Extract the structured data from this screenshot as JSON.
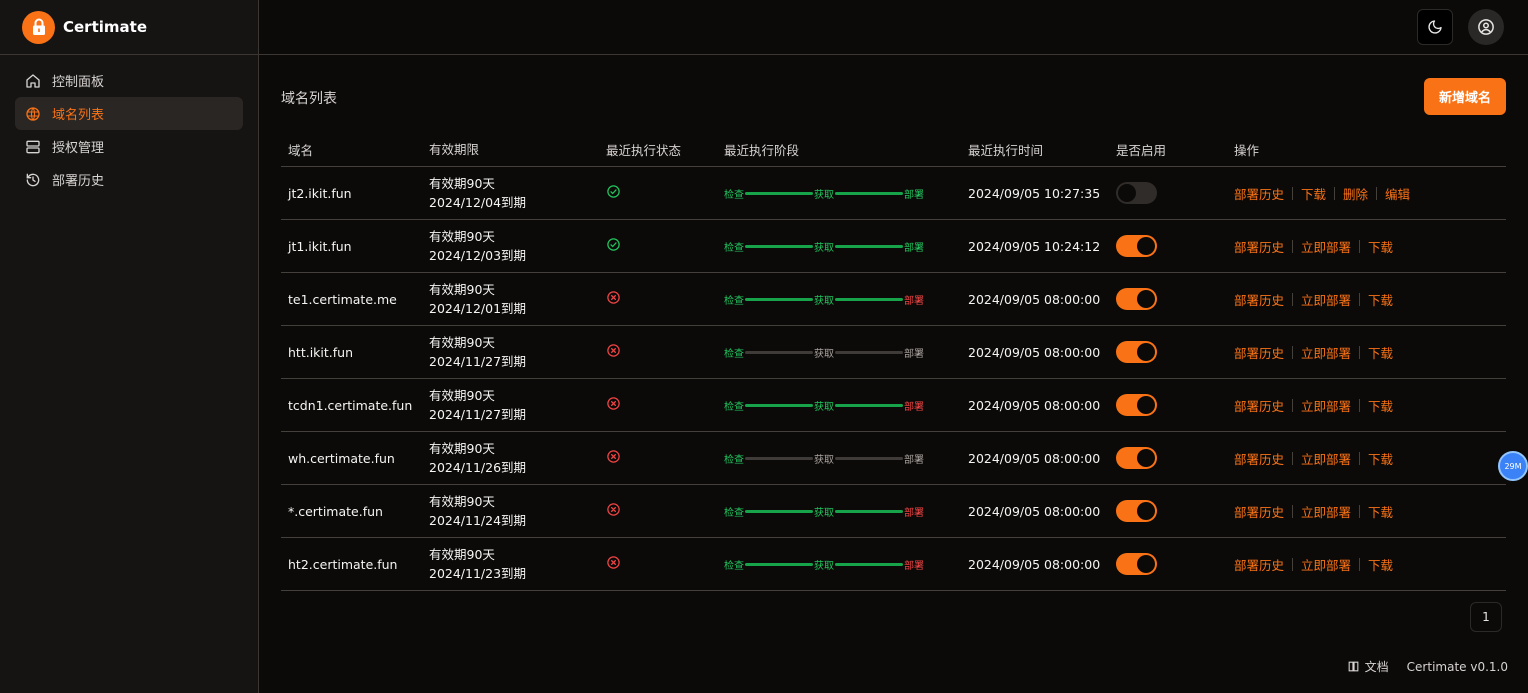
{
  "app": {
    "name": "Certimate"
  },
  "sidebar": {
    "items": [
      {
        "label": "控制面板",
        "icon": "home-icon",
        "active": false
      },
      {
        "label": "域名列表",
        "icon": "globe-icon",
        "active": true
      },
      {
        "label": "授权管理",
        "icon": "server-icon",
        "active": false
      },
      {
        "label": "部署历史",
        "icon": "history-icon",
        "active": false
      }
    ]
  },
  "topbar": {
    "theme_icon": "moon-icon",
    "user_icon": "user-circle-icon"
  },
  "main": {
    "title": "域名列表",
    "add_button": "新增域名",
    "columns": [
      "域名",
      "有效期限",
      "最近执行状态",
      "最近执行阶段",
      "最近执行时间",
      "是否启用",
      "操作"
    ],
    "stage_labels": [
      "检查",
      "获取",
      "部署"
    ],
    "rows": [
      {
        "domain": "jt2.ikit.fun",
        "valid_days": "有效期90天",
        "expire": "2024/12/04到期",
        "status": "success",
        "stages": [
          "green",
          "green",
          "green"
        ],
        "time": "2024/09/05 10:27:35",
        "enabled": false,
        "ops": [
          "部署历史",
          "下载",
          "删除",
          "编辑"
        ]
      },
      {
        "domain": "jt1.ikit.fun",
        "valid_days": "有效期90天",
        "expire": "2024/12/03到期",
        "status": "success",
        "stages": [
          "green",
          "green",
          "green"
        ],
        "time": "2024/09/05 10:24:12",
        "enabled": true,
        "ops": [
          "部署历史",
          "立即部署",
          "下载"
        ]
      },
      {
        "domain": "te1.certimate.me",
        "valid_days": "有效期90天",
        "expire": "2024/12/01到期",
        "status": "error",
        "stages": [
          "green",
          "green",
          "red"
        ],
        "time": "2024/09/05 08:00:00",
        "enabled": true,
        "ops": [
          "部署历史",
          "立即部署",
          "下载"
        ]
      },
      {
        "domain": "htt.ikit.fun",
        "valid_days": "有效期90天",
        "expire": "2024/11/27到期",
        "status": "error",
        "stages": [
          "green",
          "gray",
          "gray"
        ],
        "time": "2024/09/05 08:00:00",
        "enabled": true,
        "ops": [
          "部署历史",
          "立即部署",
          "下载"
        ]
      },
      {
        "domain": "tcdn1.certimate.fun",
        "valid_days": "有效期90天",
        "expire": "2024/11/27到期",
        "status": "error",
        "stages": [
          "green",
          "green",
          "red"
        ],
        "time": "2024/09/05 08:00:00",
        "enabled": true,
        "ops": [
          "部署历史",
          "立即部署",
          "下载"
        ]
      },
      {
        "domain": "wh.certimate.fun",
        "valid_days": "有效期90天",
        "expire": "2024/11/26到期",
        "status": "error",
        "stages": [
          "green",
          "gray",
          "gray"
        ],
        "time": "2024/09/05 08:00:00",
        "enabled": true,
        "ops": [
          "部署历史",
          "立即部署",
          "下载"
        ]
      },
      {
        "domain": "*.certimate.fun",
        "valid_days": "有效期90天",
        "expire": "2024/11/24到期",
        "status": "error",
        "stages": [
          "green",
          "green",
          "red"
        ],
        "time": "2024/09/05 08:00:00",
        "enabled": true,
        "ops": [
          "部署历史",
          "立即部署",
          "下载"
        ]
      },
      {
        "domain": "ht2.certimate.fun",
        "valid_days": "有效期90天",
        "expire": "2024/11/23到期",
        "status": "error",
        "stages": [
          "green",
          "green",
          "red"
        ],
        "time": "2024/09/05 08:00:00",
        "enabled": true,
        "ops": [
          "部署历史",
          "立即部署",
          "下载"
        ]
      }
    ],
    "page": "1"
  },
  "float_badge": "29M",
  "footer": {
    "doc": "文档",
    "version": "Certimate v0.1.0"
  },
  "colors": {
    "accent": "#f97316",
    "success": "#22c55e",
    "error": "#ef4444"
  }
}
